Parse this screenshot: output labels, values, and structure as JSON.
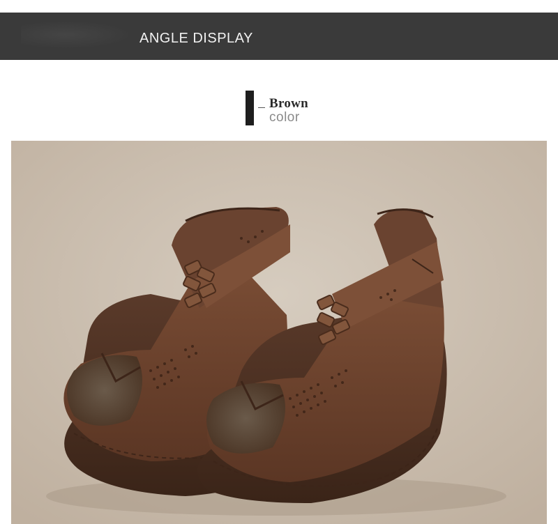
{
  "banner": {
    "title": "ANGLE DISPLAY",
    "background_color": "#3a3a3a"
  },
  "color_label": {
    "name": "Brown",
    "suffix": "color"
  },
  "product_photo": {
    "subject": "pair of brown woven leather wedge sandals",
    "leather_color": "#6e4530"
  }
}
